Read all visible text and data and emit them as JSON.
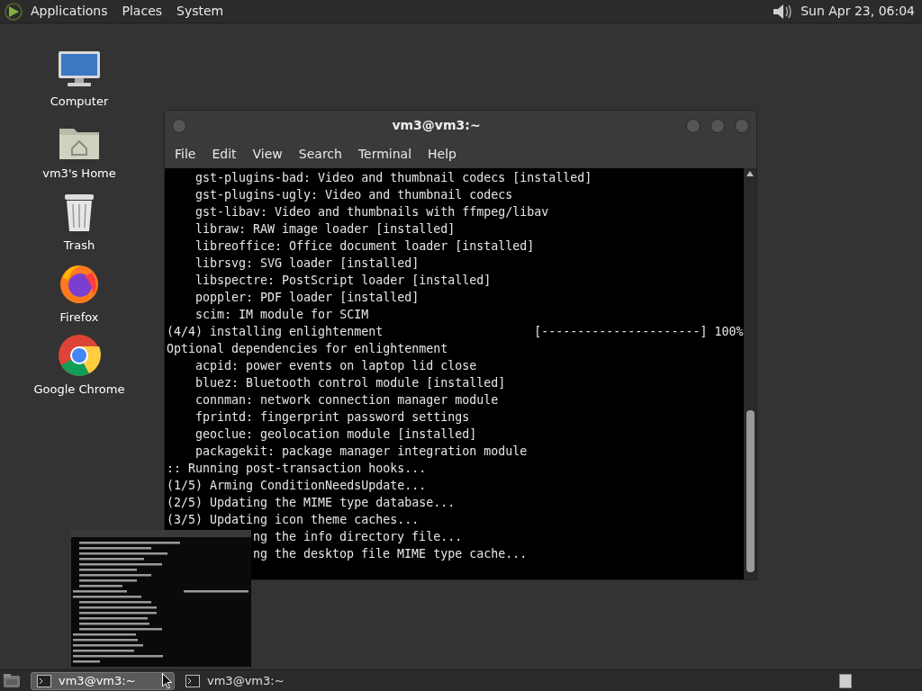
{
  "top_panel": {
    "menus": [
      "Applications",
      "Places",
      "System"
    ],
    "clock": "Sun Apr 23, 06:04"
  },
  "desktop_icons": [
    {
      "kind": "computer",
      "label": "Computer"
    },
    {
      "kind": "home",
      "label": "vm3's Home"
    },
    {
      "kind": "trash",
      "label": "Trash"
    },
    {
      "kind": "firefox",
      "label": "Firefox"
    },
    {
      "kind": "chrome",
      "label": "Google Chrome"
    }
  ],
  "terminal": {
    "title": "vm3@vm3:~",
    "menu": [
      "File",
      "Edit",
      "View",
      "Search",
      "Terminal",
      "Help"
    ],
    "lines": [
      {
        "kind": "full",
        "text": "    gst-plugins-bad: Video and thumbnail codecs [installed]"
      },
      {
        "kind": "full",
        "text": "    gst-plugins-ugly: Video and thumbnail codecs"
      },
      {
        "kind": "full",
        "text": "    gst-libav: Video and thumbnails with ffmpeg/libav"
      },
      {
        "kind": "full",
        "text": "    libraw: RAW image loader [installed]"
      },
      {
        "kind": "full",
        "text": "    libreoffice: Office document loader [installed]"
      },
      {
        "kind": "full",
        "text": "    librsvg: SVG loader [installed]"
      },
      {
        "kind": "full",
        "text": "    libspectre: PostScript loader [installed]"
      },
      {
        "kind": "full",
        "text": "    poppler: PDF loader [installed]"
      },
      {
        "kind": "full",
        "text": "    scim: IM module for SCIM"
      },
      {
        "kind": "full",
        "text": "(4/4) installing enlightenment                     [----------------------] 100%"
      },
      {
        "kind": "full",
        "text": "Optional dependencies for enlightenment"
      },
      {
        "kind": "full",
        "text": "    acpid: power events on laptop lid close"
      },
      {
        "kind": "full",
        "text": "    bluez: Bluetooth control module [installed]"
      },
      {
        "kind": "full",
        "text": "    connman: network connection manager module"
      },
      {
        "kind": "full",
        "text": "    fprintd: fingerprint password settings"
      },
      {
        "kind": "full",
        "text": "    geoclue: geolocation module [installed]"
      },
      {
        "kind": "full",
        "text": "    packagekit: package manager integration module"
      },
      {
        "kind": "full",
        "text": ":: Running post-transaction hooks..."
      },
      {
        "kind": "full",
        "text": "(1/5) Arming ConditionNeedsUpdate..."
      },
      {
        "kind": "full",
        "text": "(2/5) Updating the MIME type database..."
      },
      {
        "kind": "full",
        "text": "(3/5) Updating icon theme caches..."
      },
      {
        "kind": "clipped",
        "text": "ng the info directory file..."
      },
      {
        "kind": "clipped",
        "text": "ng the desktop file MIME type cache..."
      }
    ]
  },
  "taskbar": {
    "tasks": [
      {
        "label": "vm3@vm3:~",
        "selected": true
      },
      {
        "label": "vm3@vm3:~",
        "selected": false
      }
    ]
  }
}
